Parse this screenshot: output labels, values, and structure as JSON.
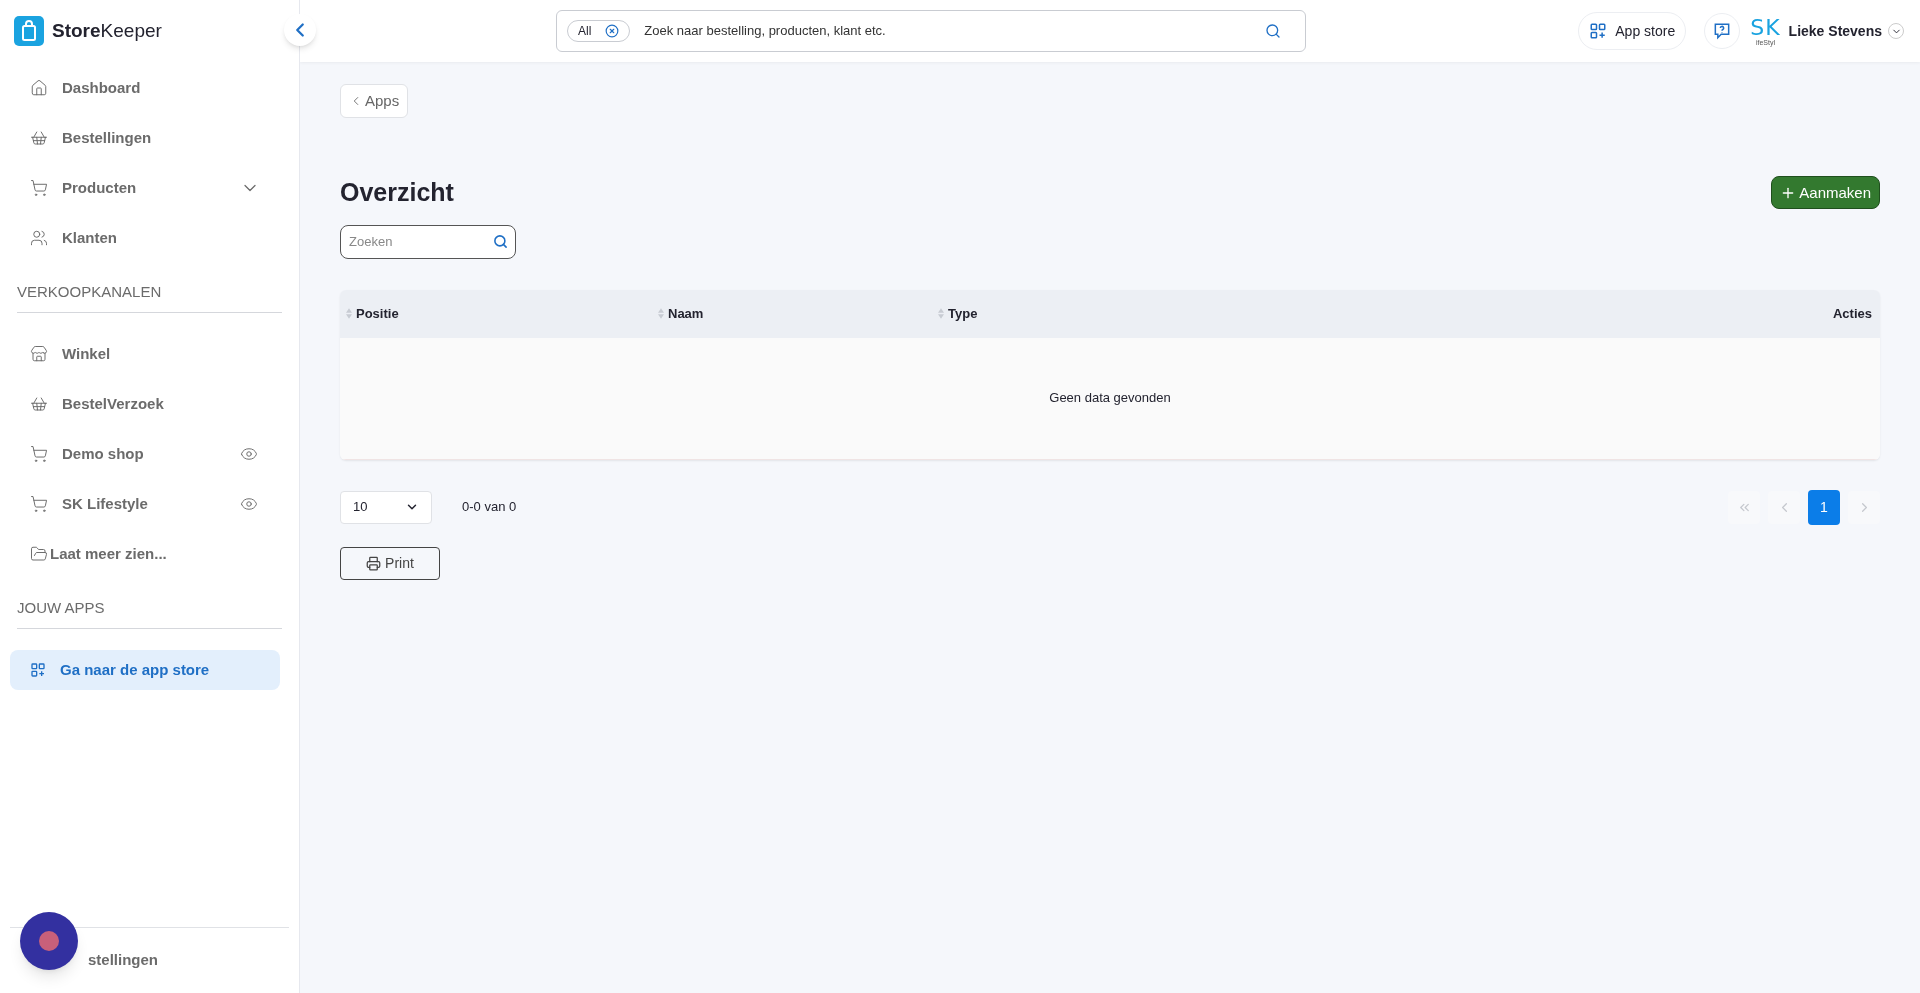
{
  "sidebar": {
    "logo": "**Store**Keeper",
    "nav": [
      {
        "label": "Dashboard",
        "selected": false
      },
      {
        "label": "Bestellingen",
        "selected": false
      },
      {
        "label": "Producten",
        "selected": false,
        "expanded": false
      },
      {
        "label": "Klanten",
        "selected": false
      }
    ],
    "sections": [
      {
        "title": "VERKOOPKANALEN",
        "items": [
          {
            "label": "Winkel",
            "selected": false,
            "preview": false
          },
          {
            "label": "BestelVerzoek",
            "selected": false,
            "preview": false
          },
          {
            "label": "Demo shop",
            "selected": false,
            "preview": true
          },
          {
            "label": "SK Lifestyle",
            "selected": false,
            "preview": true
          }
        ],
        "more": "Laat meer zien..."
      },
      {
        "title": "JOUW APPS",
        "items": [
          {
            "label": "Ga naar de app store",
            "selected": true,
            "preview": false
          }
        ]
      }
    ],
    "footer": "stellingen"
  },
  "topbar": {
    "search": {
      "filter": "All",
      "placeholder": "Zoek naar bestelling, producten, klant etc."
    },
    "app_store": "App store",
    "brand": {
      "mark": "SK",
      "sub": "ifeStyl"
    },
    "user": "Lieke Stevens"
  },
  "back": "Apps",
  "title": "Overzicht",
  "create": "Aanmaken",
  "filter": {
    "placeholder": "Zoeken"
  },
  "table": {
    "columns": [
      {
        "label": "Positie",
        "sortable": true
      },
      {
        "label": "Naam",
        "sortable": true
      },
      {
        "label": "Type",
        "sortable": true
      },
      {
        "label": "Acties",
        "sortable": false
      }
    ],
    "empty": "Geen data gevonden"
  },
  "pagination": {
    "page_size": "10",
    "range": "0-0 van 0",
    "pages": [
      {
        "label": "1",
        "selected": true
      }
    ]
  },
  "print": "Print"
}
